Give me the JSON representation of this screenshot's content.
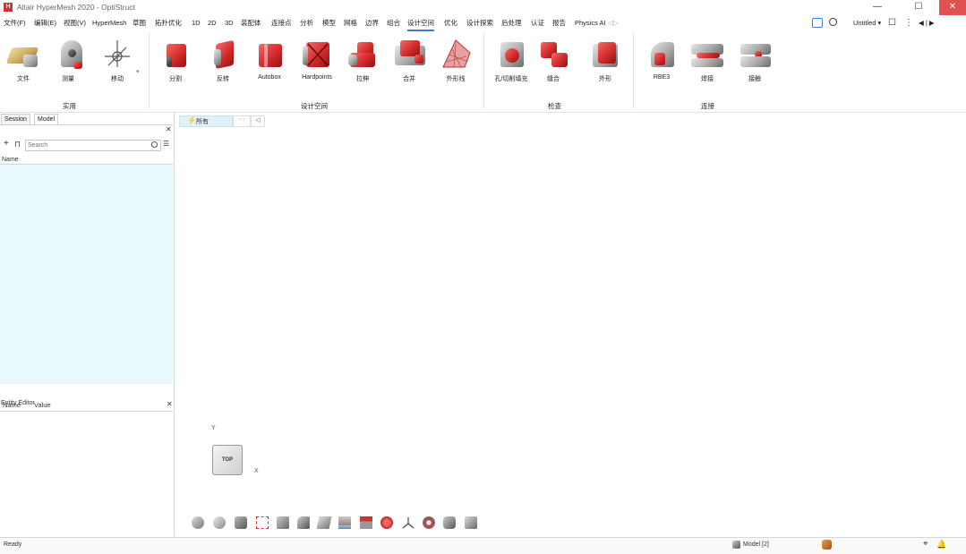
{
  "window": {
    "title": "Altair HyperMesh 2020 - OptiStruct",
    "logo": "H",
    "minimize": "—",
    "maximize": "☐",
    "close": "✕"
  },
  "menu": [
    "文件(F)",
    "编辑(E)",
    "视图(V)",
    "HyperMesh",
    "草图",
    "拓扑优化",
    "1D",
    "2D",
    "3D",
    "装配体",
    "连接点",
    "分析",
    "模型",
    "网格",
    "边界",
    "组合",
    "设计空间",
    "优化",
    "设计探索",
    "后处理",
    "认证",
    "报告",
    "Physics AI"
  ],
  "menu_active_index": 16,
  "menu_overflow": "◁▷",
  "topright": {
    "chat_icon": "chat-icon",
    "search_icon": "search-icon",
    "untitled": "Untitled ▾",
    "square_icon": "☐",
    "more": "⋮",
    "nav": "◀ | ▶"
  },
  "ribbon": {
    "groups": [
      {
        "label": "实用"
      },
      {
        "label": "设计空间"
      },
      {
        "label": "检查"
      },
      {
        "label": "连接"
      }
    ],
    "tools": {
      "file": "文件",
      "measure": "测量",
      "move": "移动",
      "tool_a": "分割",
      "tool_b": "反转",
      "autobox": "Autobox",
      "hardpoints": "Hardpoints",
      "tool_c": "拉伸",
      "tool_d": "合并",
      "tool_e": "外形线",
      "tool_f": "孔/切削填充",
      "tool_g": "缝合",
      "tool_h": "外形",
      "rbe3": "RBE3",
      "tool_i": "焊接",
      "tool_j": "接触"
    },
    "overflow": "▾"
  },
  "left_panel": {
    "tabs": [
      "Session",
      "Model"
    ],
    "close": "✕",
    "add": "+",
    "folder": "⊓",
    "search_placeholder": "Search",
    "filter_icon": "☰",
    "column_name": "Name",
    "editor_title": "Entity Editor",
    "editor_close": "✕",
    "editor_columns": [
      "Name",
      "Value"
    ]
  },
  "viewport": {
    "filter_label": "所有",
    "filter_extra": "···",
    "collapse": "◁",
    "axis_y": "Y",
    "axis_x": "X",
    "cube_face": "TOP"
  },
  "status": {
    "text": "Ready",
    "model_label": "Model [2]",
    "crosshair": "⌖",
    "bell": "🔔"
  },
  "colors": {
    "accent": "#3b7bd6",
    "close_red": "#e05252",
    "tree_bg": "#e9f8fb"
  }
}
